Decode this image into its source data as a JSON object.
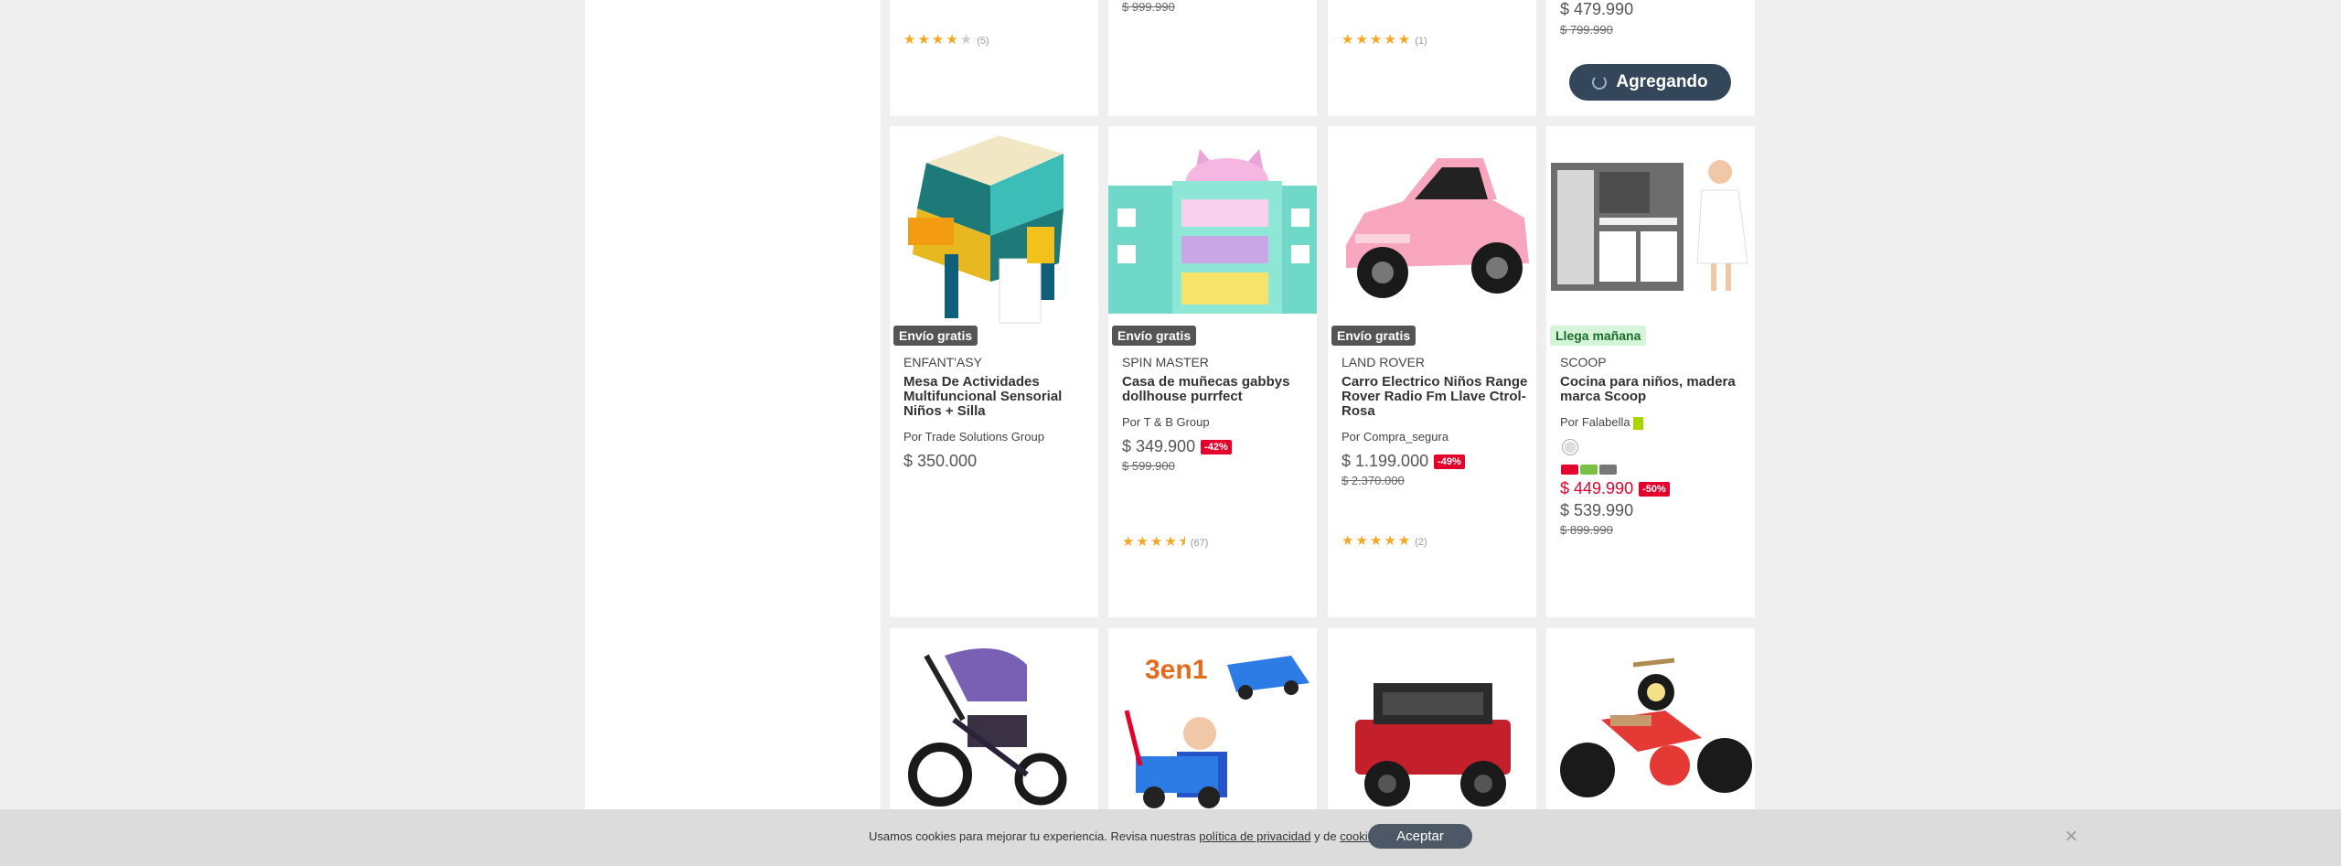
{
  "top_row": {
    "card1": {
      "rating": 4,
      "count": "(5)"
    },
    "card2": {
      "old_price": "$ 999.990"
    },
    "card3": {
      "rating": 5,
      "count": "(1)"
    },
    "card4": {
      "price": "$ 479.990",
      "old_price": "$ 799.990",
      "button_label": "Agregando"
    }
  },
  "products": [
    {
      "badge": "Envío gratis",
      "brand": "ENFANT'ASY",
      "title": "Mesa De Actividades Multifuncional Sensorial Niños + Silla",
      "seller": "Por Trade Solutions Group",
      "price": "$ 350.000"
    },
    {
      "badge": "Envío gratis",
      "brand": "SPIN MASTER",
      "title": "Casa de muñecas gabbys dollhouse purrfect",
      "seller": "Por T & B Group",
      "price": "$ 349.900",
      "discount": "-42%",
      "old_price": "$ 599.900",
      "rating": 4.5,
      "count": "(67)"
    },
    {
      "badge": "Envío gratis",
      "brand": "LAND ROVER",
      "title": "Carro Electrico Niños Range Rover Radio Fm Llave Ctrol- Rosa",
      "seller": "Por Compra_segura",
      "price": "$ 1.199.000",
      "discount": "-49%",
      "old_price": "$ 2.370.000",
      "rating": 5,
      "count": "(2)"
    },
    {
      "badge": "Llega mañana",
      "brand": "SCOOP",
      "title": "Cocina para niños, madera marca Scoop",
      "seller": "Por Falabella",
      "cmr_price": "$ 449.990",
      "discount": "-50%",
      "price": "$ 539.990",
      "old_price": "$ 899.990"
    }
  ],
  "cookie": {
    "text_before": "Usamos cookies para mejorar tu experiencia. Revisa nuestras",
    "privacy_link": "política de privacidad",
    "text_mid": "y de",
    "cookies_link": "cookies",
    "text_end": ".",
    "accept_label": "Aceptar",
    "close_icon": "×"
  },
  "colors": {
    "brand_red": "#e4002b",
    "button_dark": "#34465a",
    "star": "#f5a623"
  }
}
